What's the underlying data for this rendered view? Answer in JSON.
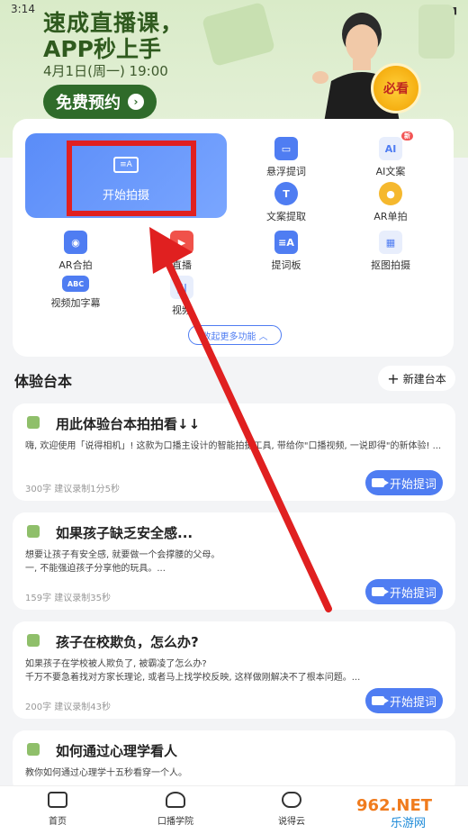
{
  "status": {
    "time": "3:14"
  },
  "banner": {
    "title_line1": "速成直播课，",
    "title_line2": "APP秒上手",
    "date": "4月1日(周一) 19:00",
    "cta": "免费预约",
    "badge": "必看"
  },
  "functions": {
    "primary": {
      "label": "开始拍摄",
      "icon": "camera-text-icon"
    },
    "items": [
      {
        "label": "悬浮提词",
        "icon": "float-prompt-icon"
      },
      {
        "label": "AI文案",
        "icon": "ai-copy-icon",
        "tag": "新"
      },
      {
        "label": "文案提取",
        "icon": "text-extract-icon"
      },
      {
        "label": "AR单拍",
        "icon": "ar-single-icon"
      },
      {
        "label": "AR合拍",
        "icon": "ar-duet-icon"
      },
      {
        "label": "直播",
        "icon": "live-icon"
      },
      {
        "label": "提词板",
        "icon": "prompt-board-icon"
      },
      {
        "label": "抠图拍摄",
        "icon": "cutout-icon"
      },
      {
        "label": "视频加字幕",
        "icon": "subtitle-icon"
      },
      {
        "label": "视频",
        "icon": "video-audio-icon"
      }
    ],
    "collapse_label": "收起更多功能"
  },
  "scripts_section": {
    "title": "体验台本",
    "new_button": "新建台本",
    "prompt_button": "开始提词",
    "cards": [
      {
        "title": "用此体验台本拍拍看↓↓",
        "desc": "嗨, 欢迎使用「说得相机」! 这款为口播主设计的智能拍摄工具, 带给你\"口播视频, 一说即得\"的新体验! ...",
        "meta": "300字 建议录制1分5秒"
      },
      {
        "title": "如果孩子缺乏安全感...",
        "desc": "想要让孩子有安全感, 就要做一个会撑腰的父母。\n一, 不能强迫孩子分享他的玩具。...",
        "meta": "159字 建议录制35秒"
      },
      {
        "title": "孩子在校欺负，怎么办?",
        "desc": "如果孩子在学校被人欺负了, 被霸凌了怎么办?\n千万不要急着找对方家长理论, 或者马上找学校反映, 这样做刚解决不了根本问题。...",
        "meta": "200字 建议录制43秒"
      },
      {
        "title": "如何通过心理学看人",
        "desc": "教你如何通过心理学十五秒看穿一个人。"
      }
    ]
  },
  "bottom_nav": [
    {
      "label": "首页",
      "icon": "home-icon"
    },
    {
      "label": "口播学院",
      "icon": "academy-icon"
    },
    {
      "label": "说得云",
      "icon": "cloud-icon"
    }
  ],
  "watermark": {
    "text1": "962.NET",
    "text2": "乐游网"
  },
  "colors": {
    "accent": "#4f7df2",
    "highlight": "#e02020",
    "banner_green": "#2f6b2a"
  }
}
